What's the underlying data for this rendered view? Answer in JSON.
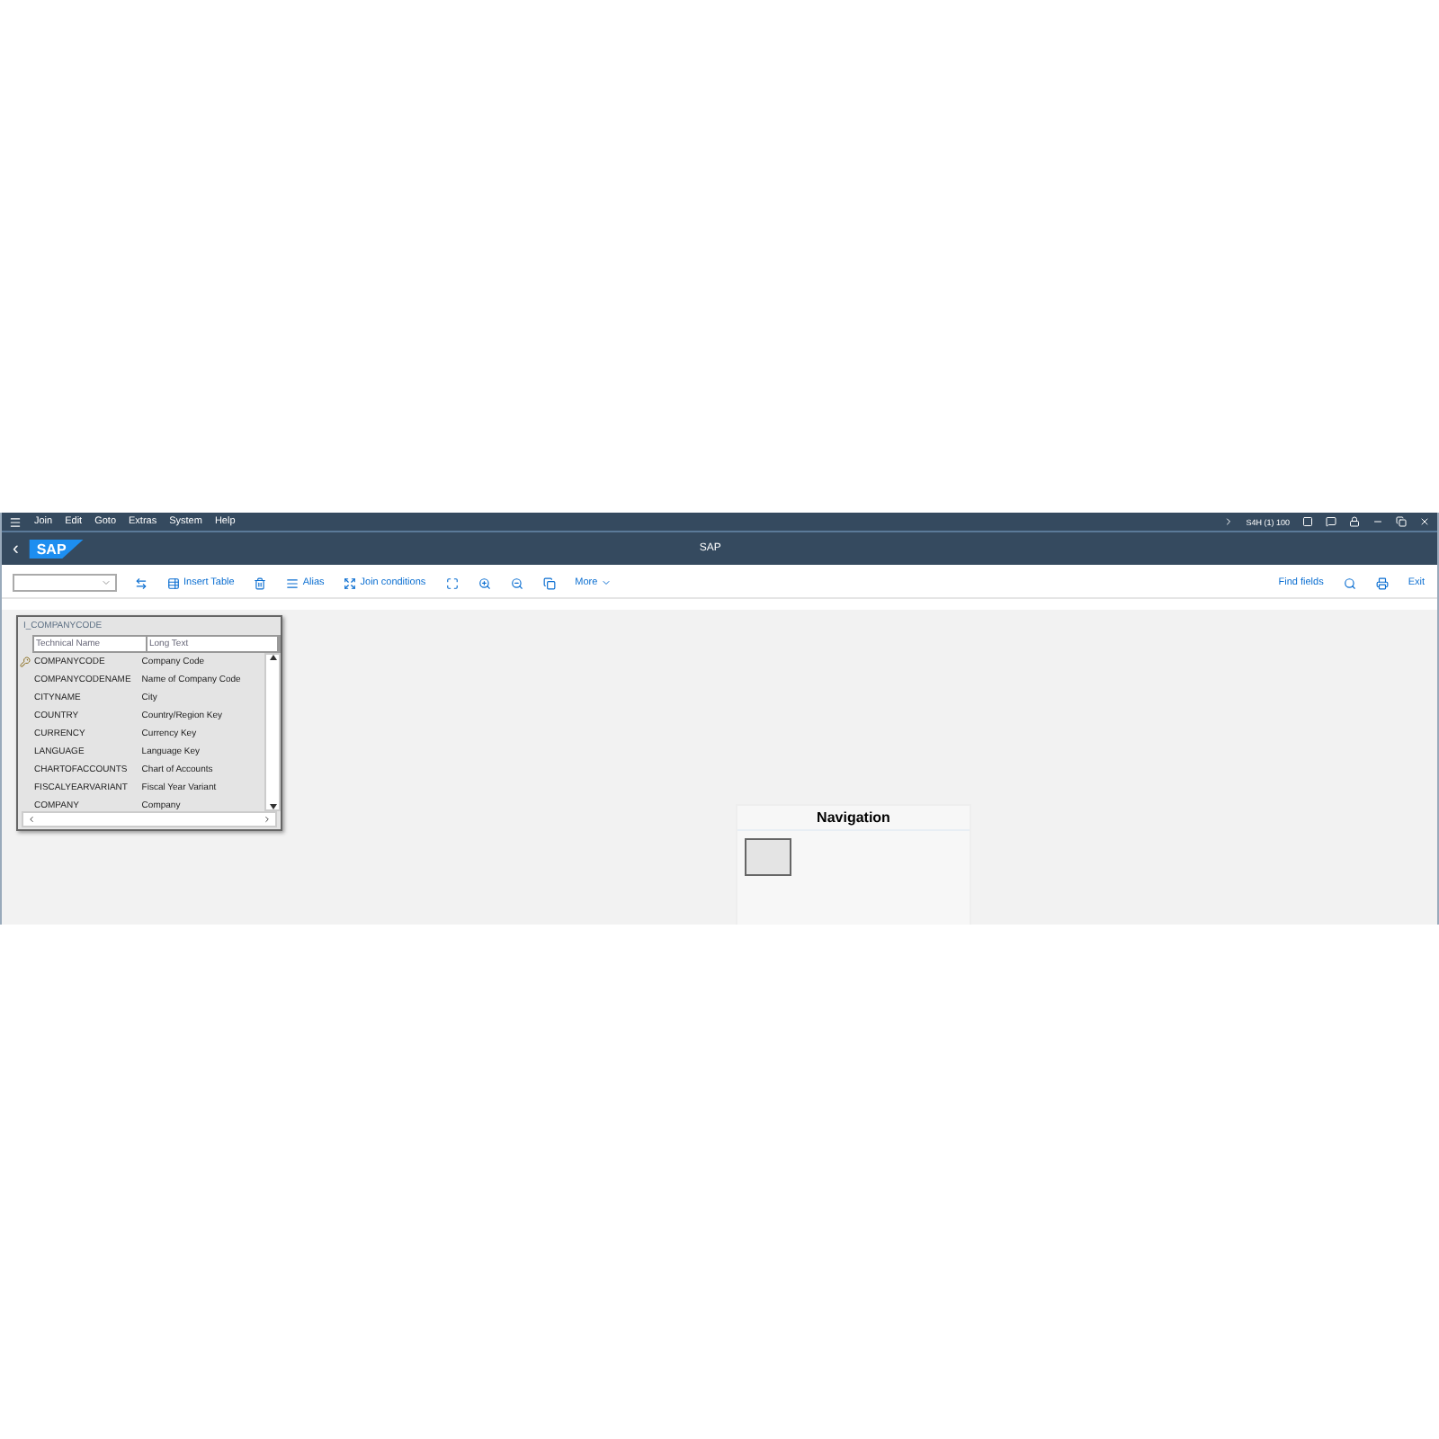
{
  "menu": [
    "Join",
    "Edit",
    "Goto",
    "Extras",
    "System",
    "Help"
  ],
  "system_info": "S4H (1) 100",
  "header": {
    "back": "‹",
    "logo": "SAP",
    "title": "SAP"
  },
  "toolbar": {
    "left": [
      {
        "kind": "icon"
      },
      {
        "kind": "text",
        "label": "Insert Table"
      },
      {
        "kind": "icon"
      },
      {
        "kind": "text",
        "label": "Alias"
      },
      {
        "kind": "text",
        "label": "Join conditions"
      },
      {
        "kind": "icon"
      },
      {
        "kind": "icon"
      },
      {
        "kind": "icon"
      },
      {
        "kind": "icon"
      },
      {
        "kind": "more",
        "label": "More"
      }
    ],
    "right": [
      {
        "kind": "text",
        "label": "Find fields"
      },
      {
        "kind": "icon"
      },
      {
        "kind": "icon"
      },
      {
        "kind": "text",
        "label": "Exit"
      }
    ]
  },
  "table_box": {
    "title": "I_COMPANYCODE",
    "columns": [
      "Technical Name",
      "Long Text"
    ],
    "rows": [
      {
        "name": "COMPANYCODE",
        "text": "Company Code",
        "key": true
      },
      {
        "name": "COMPANYCODENAME",
        "text": "Name of Company Code",
        "key": false
      },
      {
        "name": "CITYNAME",
        "text": "City",
        "key": false
      },
      {
        "name": "COUNTRY",
        "text": "Country/Region Key",
        "key": false
      },
      {
        "name": "CURRENCY",
        "text": "Currency Key",
        "key": false
      },
      {
        "name": "LANGUAGE",
        "text": "Language Key",
        "key": false
      },
      {
        "name": "CHARTOFACCOUNTS",
        "text": "Chart of Accounts",
        "key": false
      },
      {
        "name": "FISCALYEARVARIANT",
        "text": "Fiscal Year Variant",
        "key": false
      },
      {
        "name": "COMPANY",
        "text": "Company",
        "key": false
      }
    ]
  },
  "navigation": {
    "title": "Navigation"
  }
}
